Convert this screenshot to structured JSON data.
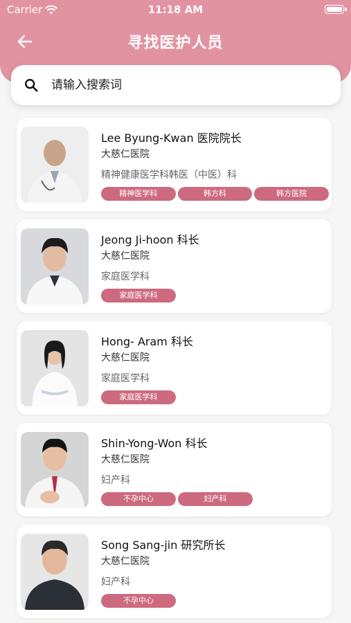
{
  "status_bar": {
    "carrier": "Carrier",
    "time": "11:18 AM"
  },
  "header": {
    "title": "寻找医护人员"
  },
  "search": {
    "placeholder": "请输入搜索词"
  },
  "colors": {
    "header": "#e293a2",
    "tag": "#cd6a80",
    "background": "#f7f6f7"
  },
  "doctors": [
    {
      "name": "Lee Byung-Kwan",
      "position": "医院院长",
      "hospital": "大慈仁医院",
      "department": "精神健康医学科韩医（中医）科",
      "tags": [
        "精神医学科",
        "韩方科",
        "韩方医院"
      ]
    },
    {
      "name": "Jeong Ji-hoon",
      "position": "科长",
      "hospital": "大慈仁医院",
      "department": "家庭医学科",
      "tags": [
        "家庭医学科"
      ]
    },
    {
      "name": "Hong- Aram",
      "position": "科长",
      "hospital": "大慈仁医院",
      "department": "家庭医学科",
      "tags": [
        "家庭医学科"
      ]
    },
    {
      "name": "Shin-Yong-Won",
      "position": "科长",
      "hospital": "大慈仁医院",
      "department": "妇产科",
      "tags": [
        "不孕中心",
        "妇产科"
      ]
    },
    {
      "name": "Song Sang-jin",
      "position": "研究所长",
      "hospital": "大慈仁医院",
      "department": "妇产科",
      "tags": [
        "不孕中心"
      ]
    }
  ]
}
